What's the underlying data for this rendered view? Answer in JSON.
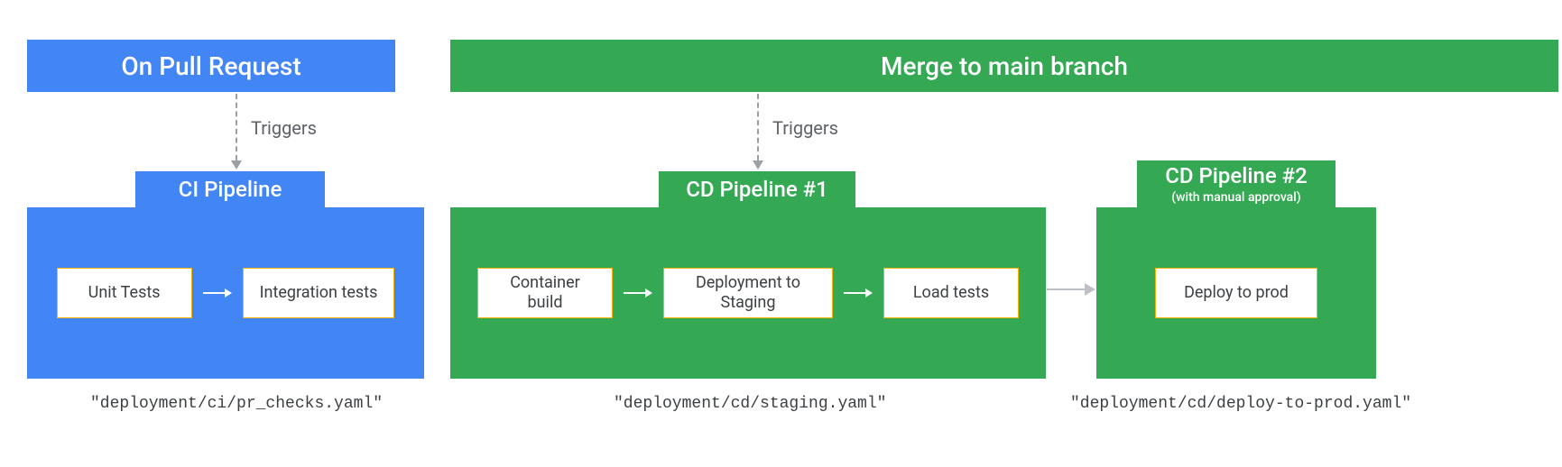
{
  "ci_header": "On Pull Request",
  "cd_header": "Merge to main branch",
  "triggers_label": "Triggers",
  "ci_pipeline": {
    "title": "CI Pipeline",
    "steps": [
      "Unit Tests",
      "Integration tests"
    ],
    "yaml": "\"deployment/ci/pr_checks.yaml\""
  },
  "cd_pipeline_1": {
    "title": "CD Pipeline #1",
    "steps": [
      "Container build",
      "Deployment to Staging",
      "Load tests"
    ],
    "yaml": "\"deployment/cd/staging.yaml\""
  },
  "cd_pipeline_2": {
    "title": "CD Pipeline #2",
    "subtitle": "(with manual approval)",
    "steps": [
      "Deploy to prod"
    ],
    "yaml": "\"deployment/cd/deploy-to-prod.yaml\""
  }
}
